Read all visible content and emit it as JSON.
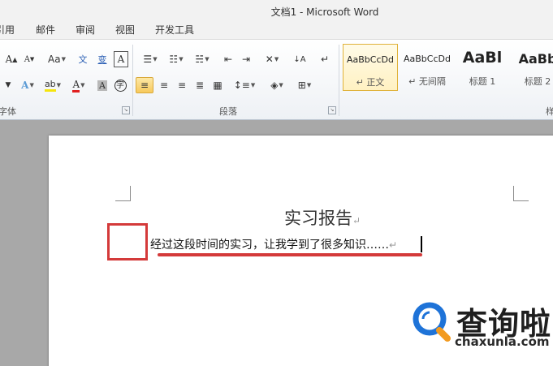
{
  "window": {
    "title": "文档1 - Microsoft Word"
  },
  "tabs": [
    "引用",
    "邮件",
    "审阅",
    "视图",
    "开发工具"
  ],
  "ribbon": {
    "font_group_label": "字体",
    "paragraph_group_label": "段落",
    "font_buttons": {
      "grow": "A",
      "shrink": "A",
      "change_case": "Aa",
      "phonetic": "文",
      "char_border": "A",
      "effects": "A",
      "highlight": "ab",
      "font_color": "A",
      "char_shading": "A",
      "enclose": "字"
    },
    "styles": [
      {
        "sample": "AaBbCcDd",
        "name": "↵ 正文"
      },
      {
        "sample": "AaBbCcDd",
        "name": "↵ 无间隔"
      },
      {
        "sample": "AaBl",
        "name": "标题 1"
      },
      {
        "sample": "AaBb",
        "name": "标题 2"
      }
    ]
  },
  "document": {
    "title": "实习报告",
    "body": "经过这段时间的实习，让我学到了很多知识……",
    "paragraph_mark": "↵"
  },
  "watermark": {
    "brand_cn": "查询啦",
    "brand_en": "chaxunla.com"
  },
  "colors": {
    "accent": "#d43a3a",
    "highlight": "#f7c95c",
    "watermark_blue": "#1e73d8",
    "watermark_orange": "#f29a1f"
  }
}
